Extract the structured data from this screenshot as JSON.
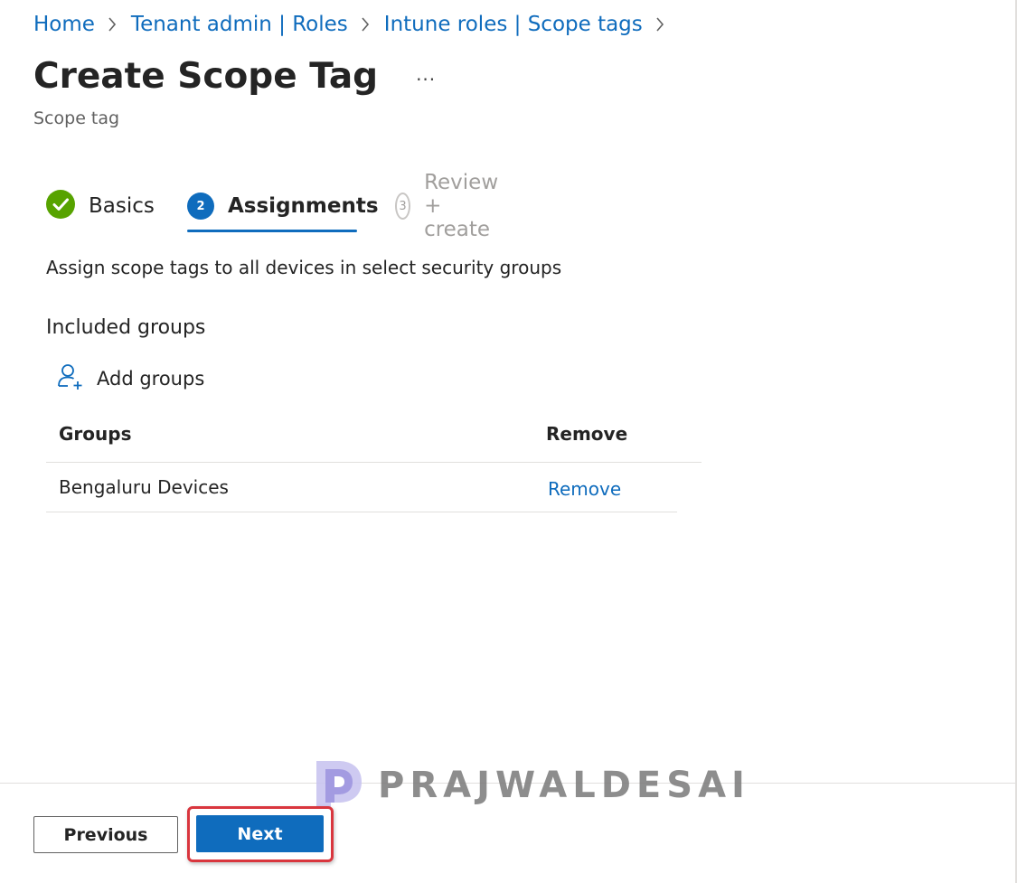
{
  "breadcrumb": {
    "items": [
      "Home",
      "Tenant admin | Roles",
      "Intune roles | Scope tags"
    ]
  },
  "header": {
    "title": "Create Scope Tag",
    "more": "...",
    "subtitle": "Scope tag"
  },
  "wizard": {
    "steps": [
      {
        "label": "Basics",
        "status": "complete"
      },
      {
        "label": "Assignments",
        "number": "2",
        "status": "active"
      },
      {
        "label": "Review + create",
        "number": "3",
        "status": "pending"
      }
    ]
  },
  "main": {
    "description": "Assign scope tags to all devices in select security groups",
    "included_heading": "Included groups",
    "add_groups_label": "Add groups",
    "table": {
      "columns": [
        "Groups",
        "Remove"
      ],
      "rows": [
        {
          "group": "Bengaluru Devices",
          "action": "Remove"
        }
      ]
    }
  },
  "footer": {
    "previous_label": "Previous",
    "next_label": "Next"
  },
  "watermark": {
    "text": "PRAJWALDESAI"
  },
  "colors": {
    "accent": "#0f6cbd",
    "success": "#57a300",
    "highlight": "#d9363e"
  }
}
